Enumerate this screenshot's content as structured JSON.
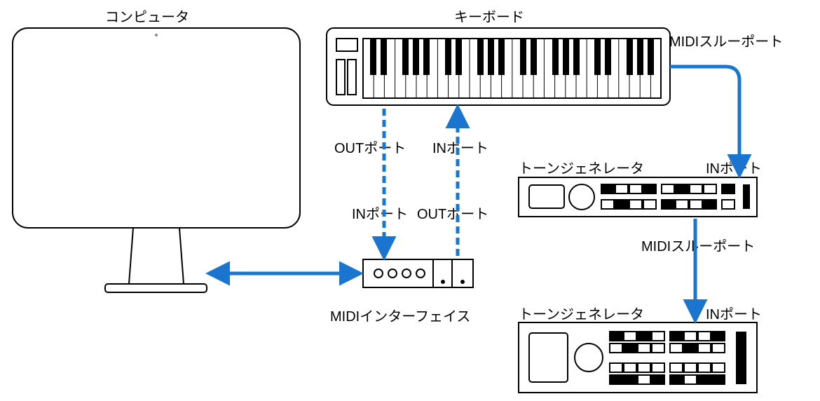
{
  "labels": {
    "computer": "コンピュータ",
    "keyboard": "キーボード",
    "midi_thru_port_1": "MIDIスルーポート",
    "midi_thru_port_2": "MIDIスルーポート",
    "tone_generator_1": "トーンジェネレータ",
    "tone_generator_2": "トーンジェネレータ",
    "in_port_tg1": "INポート",
    "in_port_tg2": "INポート",
    "out_port_kb": "OUTポート",
    "in_port_kb": "INポート",
    "in_port_if": "INポート",
    "out_port_if": "OUTポート",
    "midi_interface": "MIDIインターフェイス"
  },
  "colors": {
    "arrow": "#1a75cf",
    "line": "#000"
  }
}
